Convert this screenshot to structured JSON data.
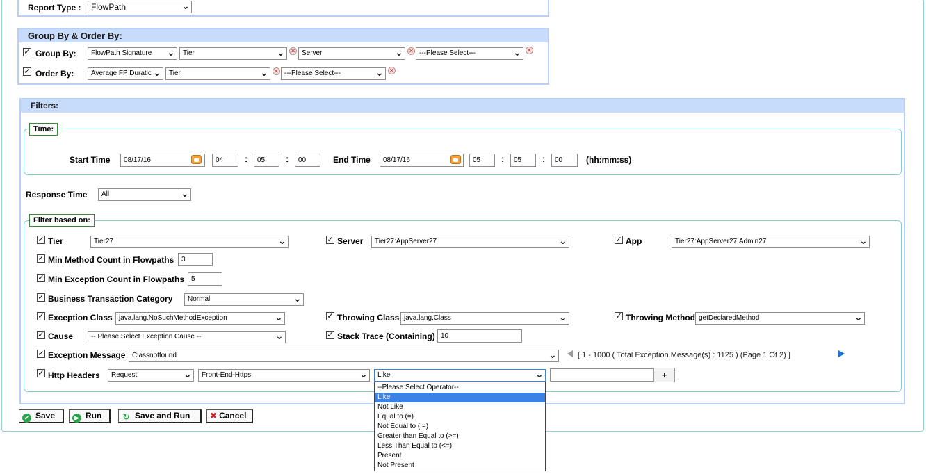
{
  "report_type": {
    "label": "Report Type :",
    "value": "FlowPath"
  },
  "group_order": {
    "title": "Group By & Order By:",
    "group_by": {
      "label": "Group By:",
      "values": [
        "FlowPath Signature",
        "Tier",
        "Server",
        "---Please Select---"
      ]
    },
    "order_by": {
      "label": "Order By:",
      "values": [
        "Average FP Duratic",
        "Tier",
        "---Please Select---"
      ]
    }
  },
  "filters": {
    "title": "Filters:",
    "time": {
      "legend": "Time:",
      "start_label": "Start Time",
      "start_date": "08/17/16",
      "start_h": "04",
      "start_m": "05",
      "start_s": "00",
      "end_label": "End Time",
      "end_date": "08/17/16",
      "end_h": "05",
      "end_m": "05",
      "end_s": "00",
      "format": "(hh:mm:ss)",
      "colon": ":"
    },
    "response_time": {
      "label": "Response Time",
      "value": "All"
    },
    "filter_based": {
      "legend": "Filter based on:",
      "tier": {
        "label": "Tier",
        "value": "Tier27"
      },
      "server": {
        "label": "Server",
        "value": "Tier27:AppServer27"
      },
      "app": {
        "label": "App",
        "value": "Tier27:AppServer27:Admin27"
      },
      "min_method": {
        "label": "Min Method Count in Flowpaths",
        "value": "3"
      },
      "min_exception": {
        "label": "Min Exception Count in Flowpaths",
        "value": "5"
      },
      "bt_category": {
        "label": "Business Transaction Category",
        "value": "Normal"
      },
      "exception_class": {
        "label": "Exception Class",
        "value": "java.lang.NoSuchMethodException"
      },
      "throwing_class": {
        "label": "Throwing Class",
        "value": "java.lang.Class"
      },
      "throwing_method": {
        "label": "Throwing Method",
        "value": "getDeclaredMethod"
      },
      "cause": {
        "label": "Cause",
        "value": "-- Please Select Exception Cause --"
      },
      "stack_trace": {
        "label": "Stack Trace (Containing)",
        "value": "10"
      },
      "exception_message": {
        "label": "Exception Message",
        "value": "Classnotfound",
        "paging": "[ 1 - 1000 ( Total Exception Message(s) : 1125 ) (Page 1 Of 2) ]"
      },
      "http_headers": {
        "label": "Http Headers",
        "type": "Request",
        "header": "Front-End-Https",
        "operator": "Like",
        "value": "",
        "add_label": "+",
        "operator_options": [
          "--Please Select Operator--",
          "Like",
          "Not Like",
          "Equal to (=)",
          "Not Equal to (!=)",
          "Greater than Equal to (>=)",
          "Less Than Equal to (<=)",
          "Present",
          "Not Present"
        ],
        "selected_option": "Like"
      }
    }
  },
  "actions": {
    "save": "Save",
    "run": "Run",
    "save_and_run": "Save and Run",
    "cancel": "Cancel"
  },
  "colors": {
    "accent_blue": "#c7dcfa",
    "panel_border": "#b9cff5",
    "legend_green": "#3b8a3b",
    "highlight": "#3b82e8"
  }
}
